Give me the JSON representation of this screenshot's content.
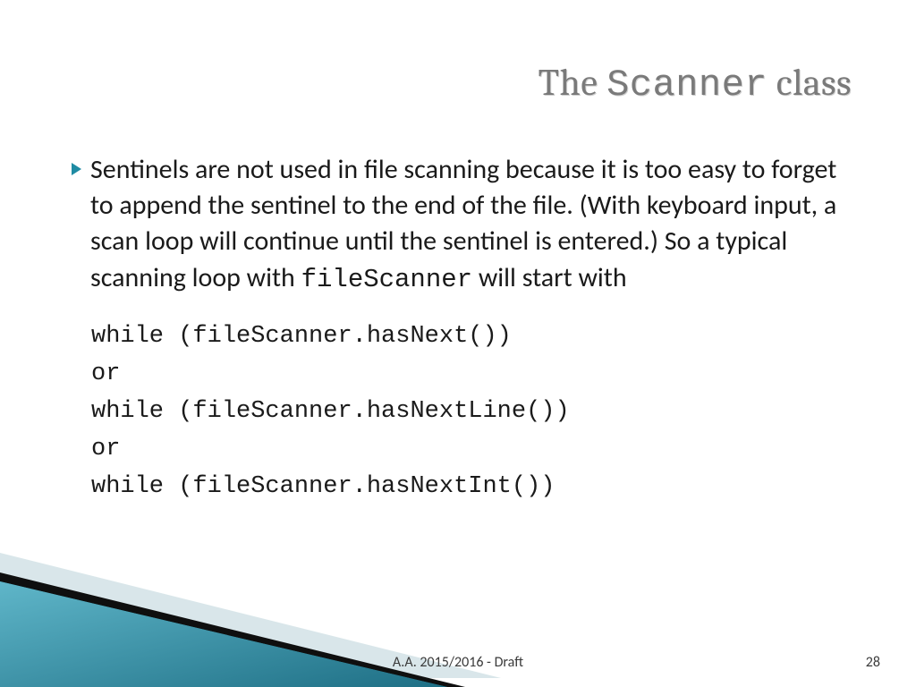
{
  "title": {
    "prefix": "The ",
    "codeword": "Scanner",
    "suffix": " class"
  },
  "bullet": {
    "part1": "Sentinels are not used in file scanning because it is too easy to forget to append the sentinel to the end of the file. (With keyboard input, a scan loop will continue until the sentinel is entered.) So a typical scanning loop with ",
    "code_inline": "fileScanner",
    "part2": " will start with"
  },
  "code": {
    "line1": "while (fileScanner.hasNext())",
    "or1": "or",
    "line2": "while (fileScanner.hasNextLine())",
    "or2": "or",
    "line3": "while (fileScanner.hasNextInt())"
  },
  "footer": "A.A. 2015/2016  -  Draft",
  "page": "28"
}
